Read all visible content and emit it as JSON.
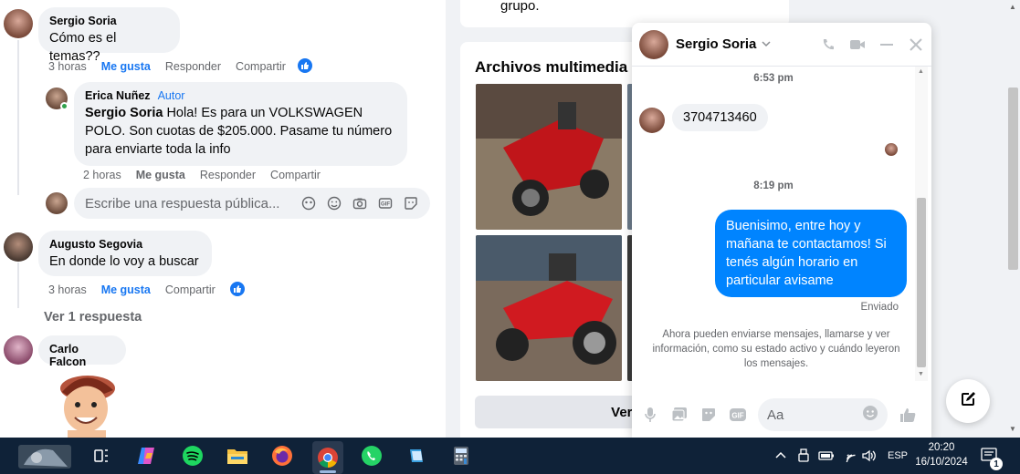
{
  "comments": [
    {
      "author": "Sergio Soria",
      "text": "Cómo es el temas??",
      "time": "3 horas",
      "like": "Me gusta",
      "reply": "Responder",
      "share": "Compartir"
    },
    {
      "author": "Erica Nuñez",
      "role": "Autor",
      "mention": "Sergio Soria",
      "text": "Hola! Es para un VOLKSWAGEN POLO. Son cuotas de $205.000. Pasame tu número para enviarte toda la info",
      "time": "2 horas",
      "like": "Me gusta",
      "reply": "Responder",
      "share": "Compartir"
    },
    {
      "author": "Augusto Segovia",
      "text": "En donde lo voy a buscar",
      "time": "3 horas",
      "like": "Me gusta",
      "share": "Compartir"
    },
    {
      "author": "Carlo Falcon"
    }
  ],
  "reply_box": {
    "placeholder": "Escribe una respuesta pública..."
  },
  "view_replies": "Ver 1 respuesta",
  "media": {
    "top_text": "grupo.",
    "title": "Archivos multimedia re",
    "view_all": "Ver to"
  },
  "chat": {
    "name": "Sergio Soria",
    "time1": "6:53 pm",
    "incoming": "3704713460",
    "time2": "8:19 pm",
    "outgoing": "Buenisimo, entre hoy y mañana te contactamos! Si tenés algún horario en particular avisame",
    "status": "Enviado",
    "notice": "Ahora pueden enviarse mensajes, llamarse y ver información, como su estado activo y cuándo leyeron los mensajes.",
    "composer_placeholder": "Aa"
  },
  "taskbar": {
    "lang": "ESP",
    "time": "20:20",
    "date": "16/10/2024",
    "notification_count": "1"
  },
  "colors": {
    "facebook_blue": "#1877f2",
    "messenger_blue": "#0084ff",
    "taskbar": "#0f2238"
  }
}
